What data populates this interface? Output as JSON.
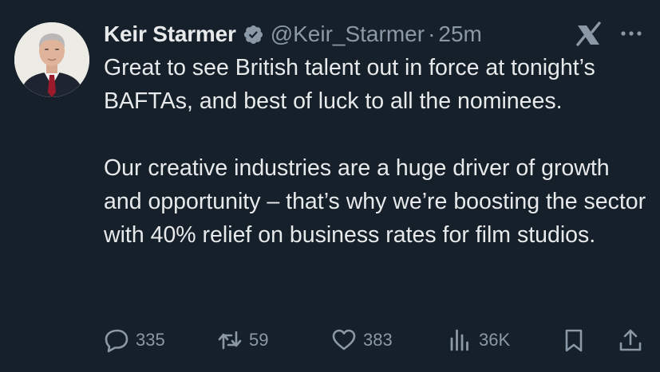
{
  "user": {
    "name": "Keir Starmer",
    "handle": "@Keir_Starmer",
    "separator": "·",
    "time": "25m"
  },
  "tweet": {
    "paragraphs": [
      "Great to see British talent out in force at tonight’s BAFTAs, and best of luck to all the nominees.",
      "Our creative industries are a huge driver of growth and opportunity – that’s why we’re boosting the sector with 40% relief on business rates for film studios."
    ]
  },
  "actions": {
    "replies": "335",
    "reposts": "59",
    "likes": "383",
    "views": "36K"
  },
  "icons": [
    "avatar",
    "verified-icon",
    "grok-icon",
    "more-icon",
    "reply-icon",
    "repost-icon",
    "like-icon",
    "views-icon",
    "bookmark-icon",
    "share-icon"
  ],
  "colors": {
    "background": "#15202b",
    "text": "#e7e9ea",
    "secondary": "#8b98a5",
    "verified_badge": "#8b98a5"
  }
}
